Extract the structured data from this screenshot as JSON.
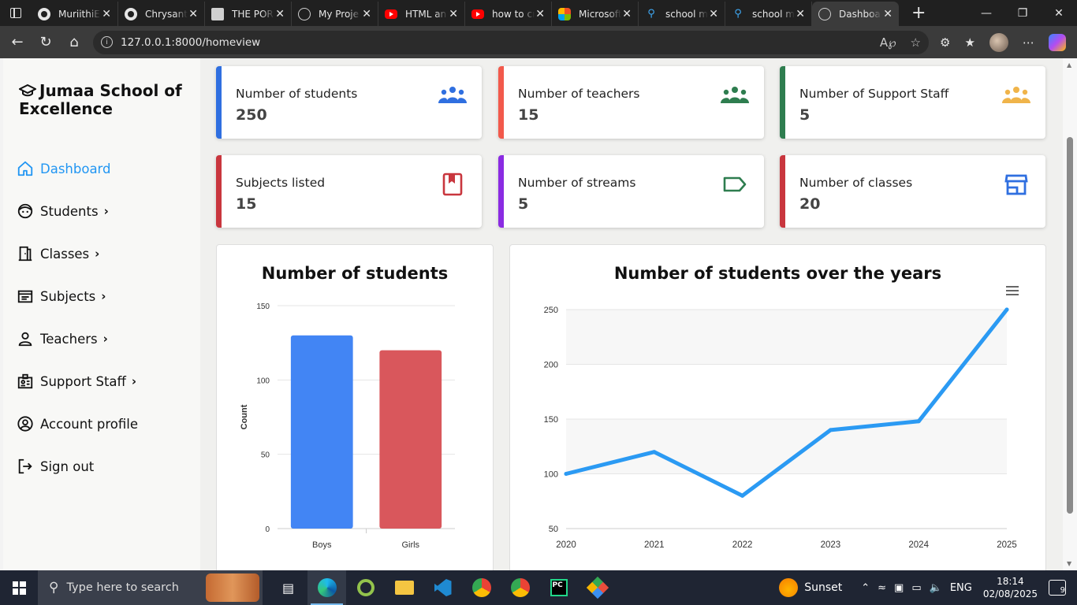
{
  "browser": {
    "tabs": [
      {
        "title": "MuriithiE",
        "icon": "github-icon"
      },
      {
        "title": "Chrysanth",
        "icon": "github-icon"
      },
      {
        "title": "THE POR",
        "icon": "document-icon"
      },
      {
        "title": "My Proje",
        "icon": "globe-icon"
      },
      {
        "title": "HTML an",
        "icon": "youtube-icon"
      },
      {
        "title": "how to cr",
        "icon": "youtube-icon"
      },
      {
        "title": "Microsoft",
        "icon": "microsoft-icon"
      },
      {
        "title": "school m",
        "icon": "bing-search-icon"
      },
      {
        "title": "school m",
        "icon": "bing-search-icon"
      },
      {
        "title": "Dashboar",
        "icon": "globe-icon",
        "active": true
      }
    ],
    "url": "127.0.0.1:8000/homeview"
  },
  "sidebar": {
    "brand": "Jumaa School of Excellence",
    "items": [
      {
        "label": "Dashboard",
        "icon": "home-icon",
        "active": true,
        "has_submenu": false
      },
      {
        "label": "Students",
        "icon": "face-icon",
        "has_submenu": true
      },
      {
        "label": "Classes",
        "icon": "door-icon",
        "has_submenu": true
      },
      {
        "label": "Subjects",
        "icon": "list-box-icon",
        "has_submenu": true
      },
      {
        "label": "Teachers",
        "icon": "person-icon",
        "has_submenu": true
      },
      {
        "label": "Support Staff",
        "icon": "id-badge-icon",
        "has_submenu": true
      },
      {
        "label": "Account profile",
        "icon": "account-circle-icon",
        "has_submenu": false
      },
      {
        "label": "Sign out",
        "icon": "sign-out-icon",
        "has_submenu": false
      }
    ]
  },
  "cards": [
    {
      "label": "Number of students",
      "value": "250",
      "color": "#2f6fe0",
      "icon": "people-group-icon"
    },
    {
      "label": "Number of teachers",
      "value": "15",
      "color": "#f2594b",
      "icon": "people-group-icon",
      "icon_color": "#2e7d4f"
    },
    {
      "label": "Number of Support Staff",
      "value": "5",
      "color": "#2e7d4f",
      "icon": "people-group-icon",
      "icon_color": "#f0b44a"
    },
    {
      "label": "Subjects listed",
      "value": "15",
      "color": "#c9363e",
      "icon": "bookmark-book-icon"
    },
    {
      "label": "Number of streams",
      "value": "5",
      "color": "#8a2be2",
      "icon": "tag-icon",
      "icon_color": "#2e7d4f"
    },
    {
      "label": "Number of classes",
      "value": "20",
      "color": "#c9363e",
      "icon": "store-icon",
      "icon_color": "#2f6fe0"
    }
  ],
  "chart_data": [
    {
      "type": "bar",
      "title": "Number of students",
      "categories": [
        "Boys",
        "Girls"
      ],
      "values": [
        130,
        120
      ],
      "colors": [
        "#4285f4",
        "#d9575c"
      ],
      "xlabel": "",
      "ylabel": "Count",
      "ylim": [
        0,
        150
      ],
      "yticks": [
        0,
        50,
        100,
        150
      ],
      "grid": true
    },
    {
      "type": "line",
      "title": "Number of students over the years",
      "x": [
        2020,
        2021,
        2022,
        2023,
        2024,
        2025
      ],
      "values": [
        100,
        120,
        80,
        140,
        148,
        250
      ],
      "color": "#2b9af3",
      "ylim": [
        50,
        250
      ],
      "yticks": [
        50,
        100,
        150,
        200,
        250
      ],
      "grid": true
    }
  ],
  "taskbar": {
    "search_placeholder": "Type here to search",
    "weather": "Sunset",
    "language": "ENG",
    "time": "18:14",
    "date": "02/08/2025",
    "notifications": "9"
  }
}
